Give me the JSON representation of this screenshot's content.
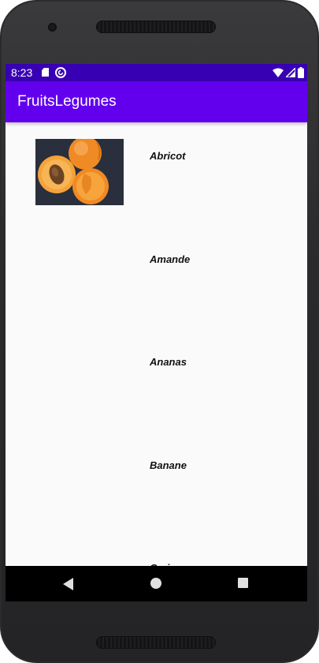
{
  "status_bar": {
    "time": "8:23",
    "icons": [
      "sd-card-icon",
      "sync-icon",
      "wifi-icon",
      "signal-icon",
      "battery-icon"
    ],
    "color": "#3700b3"
  },
  "app_bar": {
    "title": "FruitsLegumes",
    "color": "#6200ee"
  },
  "fruits": [
    {
      "label": "Abricot",
      "has_image": true
    },
    {
      "label": "Amande",
      "has_image": false
    },
    {
      "label": "Ananas",
      "has_image": false
    },
    {
      "label": "Banane",
      "has_image": false
    },
    {
      "label": "Cerise",
      "has_image": false
    }
  ],
  "nav_bar": {
    "buttons": [
      "back-icon",
      "home-icon",
      "recents-icon"
    ]
  }
}
